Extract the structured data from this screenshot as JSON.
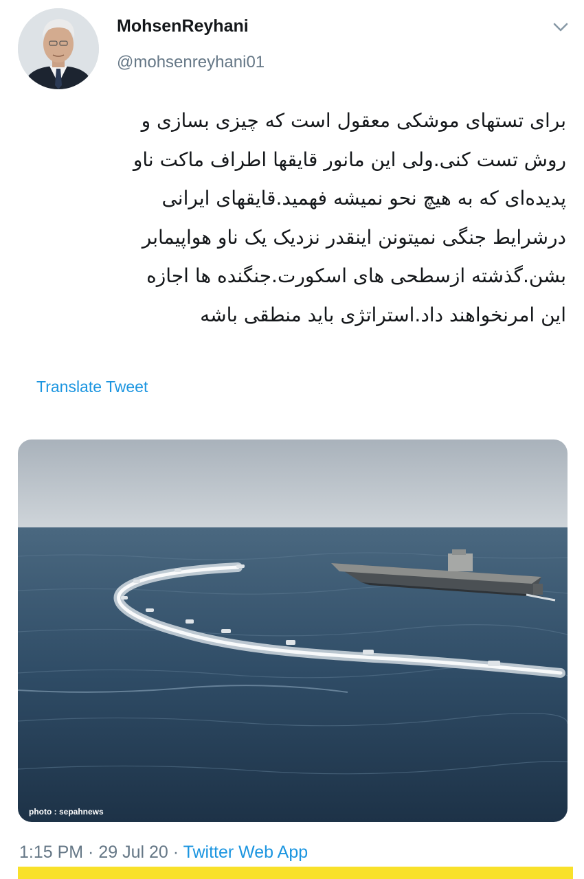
{
  "user": {
    "display_name": "MohsenReyhani",
    "handle": "@mohsenreyhani01"
  },
  "tweet": {
    "lines": [
      "برای تستهای موشکی معقول است که چیزی بسازی و",
      "روش تست کنی.ولی این مانور قایقها اطراف ماکت ناو",
      "پدیده‌ای که به هیچ نحو نمیشه فهمید.قایقهای ایرانی",
      "درشرایط جنگی نمیتونن اینقدر نزدیک یک ناو هواپیمابر",
      "بشن.گذشته ازسطحی های اسکورت.جنگنده ها اجازه",
      "این امرنخواهند داد.استراتژی باید منطقی باشه"
    ],
    "translate_label": "Translate Tweet",
    "time": "1:15 PM",
    "date": "29 Jul 20",
    "separator": " · ",
    "source": "Twitter Web App"
  },
  "media": {
    "watermark": "photo : sepahnews"
  },
  "icons": {
    "caret": "chevron-down-icon"
  },
  "colors": {
    "link": "#1b95e0",
    "secondary_text": "#657786",
    "highlight": "#f9e12a"
  }
}
